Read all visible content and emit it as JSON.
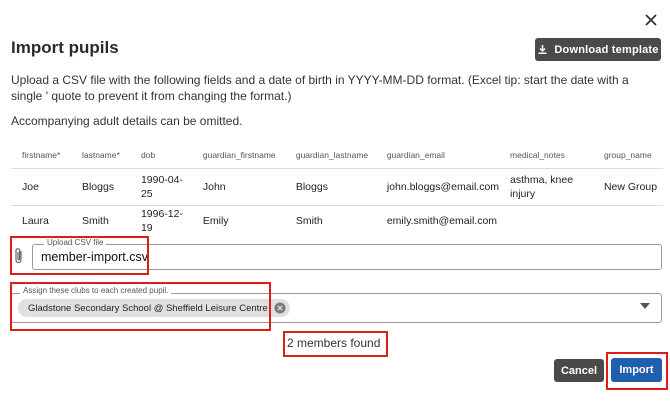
{
  "dialog": {
    "title": "Import pupils",
    "download_label": "Download template",
    "description": "Upload a CSV file with the following fields and a date of birth in YYYY-MM-DD format. (Excel tip: start the date with a single ' quote to prevent it from changing the format.)",
    "adult_note": "Accompanying adult details can be omitted."
  },
  "table": {
    "columns": [
      "firstname*",
      "lastname*",
      "dob",
      "guardian_firstname",
      "guardian_lastname",
      "guardian_email",
      "medical_notes",
      "group_name"
    ],
    "rows": [
      [
        "Joe",
        "Bloggs",
        "1990-04-25",
        "John",
        "Bloggs",
        "john.bloggs@email.com",
        "asthma, knee injury",
        "New Group"
      ],
      [
        "Laura",
        "Smith",
        "1996-12-19",
        "Emily",
        "Smith",
        "emily.smith@email.com",
        "",
        ""
      ]
    ]
  },
  "upload": {
    "label": "Upload CSV file",
    "value": "member-import.csv"
  },
  "clubs": {
    "label": "Assign these clubs to each created pupil.",
    "chip": "Gladstone Secondary School @ Sheffield Leisure Centre"
  },
  "status": "2 members found",
  "buttons": {
    "cancel": "Cancel",
    "import": "Import"
  },
  "colors": {
    "highlight": "#dd1c1c",
    "primary": "#1f5fae",
    "dark_button": "#4a4a4a"
  }
}
